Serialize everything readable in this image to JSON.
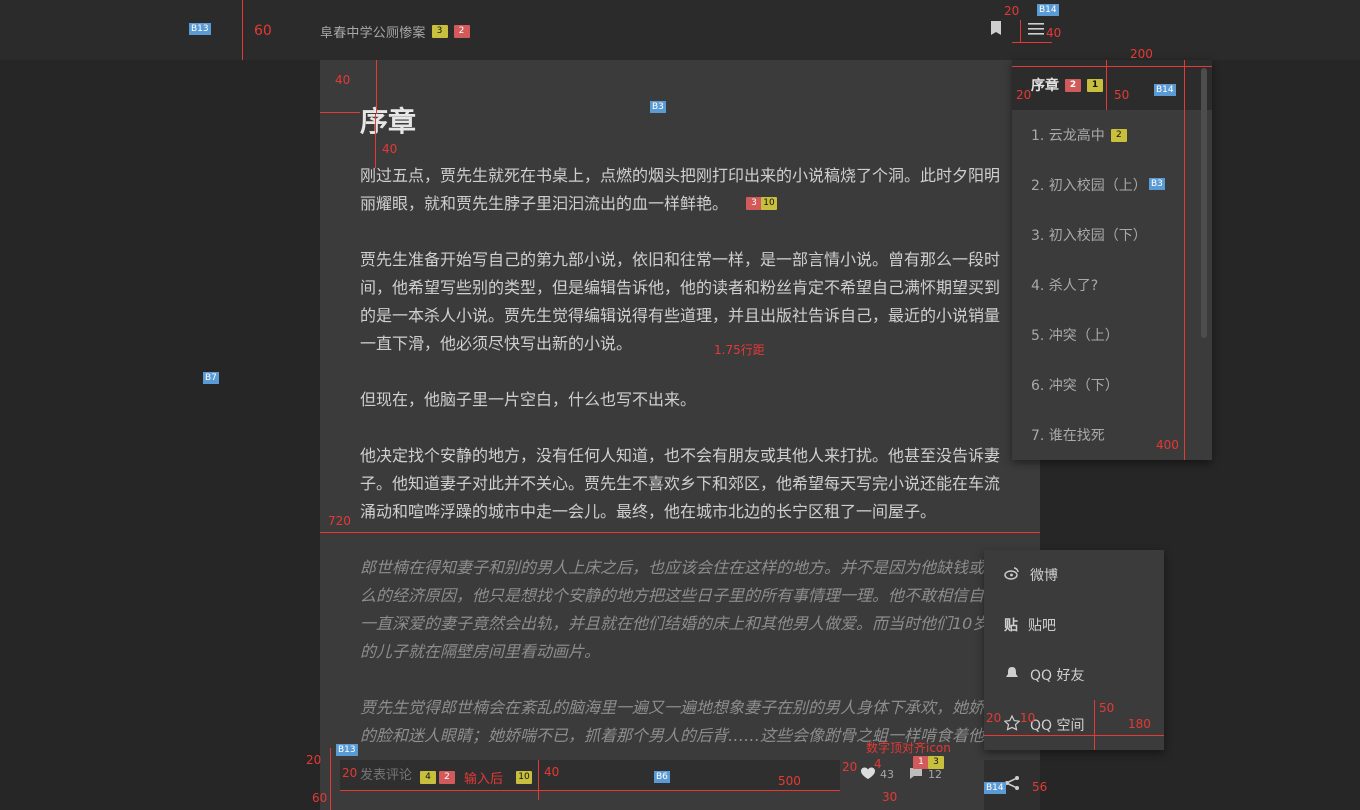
{
  "topbar": {
    "title": "阜春中学公厕惨案",
    "title_tags": [
      "3",
      "2"
    ],
    "bookmark_icon": "bookmark-icon",
    "menu_icon": "menu-icon"
  },
  "chapter": {
    "title": "序章",
    "paragraphs": [
      "刚过五点，贾先生就死在书桌上，点燃的烟头把刚打印出来的小说稿烧了个洞。此时夕阳明丽耀眼，就和贾先生脖子里汩汩流出的血一样鲜艳。",
      "贾先生准备开始写自己的第九部小说，依旧和往常一样，是一部言情小说。曾有那么一段时间，他希望写些别的类型，但是编辑告诉他，他的读者和粉丝肯定不希望自己满怀期望买到的是一本杀人小说。贾先生觉得编辑说得有些道理，并且出版社告诉自己，最近的小说销量一直下滑，他必须尽快写出新的小说。",
      "但现在，他脑子里一片空白，什么也写不出来。",
      "他决定找个安静的地方，没有任何人知道，也不会有朋友或其他人来打扰。他甚至没告诉妻子。他知道妻子对此并不关心。贾先生不喜欢乡下和郊区，他希望每天写完小说还能在车流涌动和喧哗浮躁的城市中走一会儿。最终，他在城市北边的长宁区租了一间屋子。"
    ],
    "quotes": [
      "郎世楠在得知妻子和别的男人上床之后，也应该会住在这样的地方。并不是因为他缺钱或什么的经济原因，他只是想找个安静的地方把这些日子里的所有事情理一理。他不敢相信自己一直深爱的妻子竟然会出轨，并且就在他们结婚的床上和其他男人做爱。而当时他们10岁的儿子就在隔壁房间里看动画片。",
      "贾先生觉得郎世楠会在紊乱的脑海里一遍又一遍地想象妻子在别的男人身体下承欢，她娇红的脸和迷人眼睛；她娇喘不已，抓着那个男人的后背……这些会像跗骨之蛆一样啃食着他，"
    ]
  },
  "toc": {
    "items": [
      {
        "label": "序章",
        "active": true
      },
      {
        "label": "1. 云龙高中"
      },
      {
        "label": "2. 初入校园（上）"
      },
      {
        "label": "3. 初入校园（下）"
      },
      {
        "label": "4. 杀人了?"
      },
      {
        "label": "5. 冲突（上）"
      },
      {
        "label": "6. 冲突（下）"
      },
      {
        "label": "7. 谁在找死"
      }
    ]
  },
  "comment": {
    "placeholder": "发表评论",
    "tag_a": "4",
    "tag_b": "2",
    "note": "输入后",
    "tag_c": "10",
    "like_count": "43",
    "comment_count": "12"
  },
  "share": {
    "items": [
      "微博",
      "贴吧",
      "QQ 好友",
      "QQ 空间"
    ]
  },
  "annotations": {
    "b13": "B13",
    "b14": "B14",
    "b3": "B3",
    "b7": "B7",
    "b6": "B6",
    "n60": "60",
    "n20": "20",
    "n40": "40",
    "n200": "200",
    "n50": "50",
    "n400": "400",
    "n720": "720",
    "n500": "500",
    "n4": "4",
    "n30": "30",
    "n56": "56",
    "n10": "10",
    "n180": "180",
    "line_height": "1.75行距",
    "align_note": "数字顶对齐icon",
    "tag_2": "2",
    "tag_1": "1",
    "tag_3": "3",
    "tag_10": "10"
  }
}
